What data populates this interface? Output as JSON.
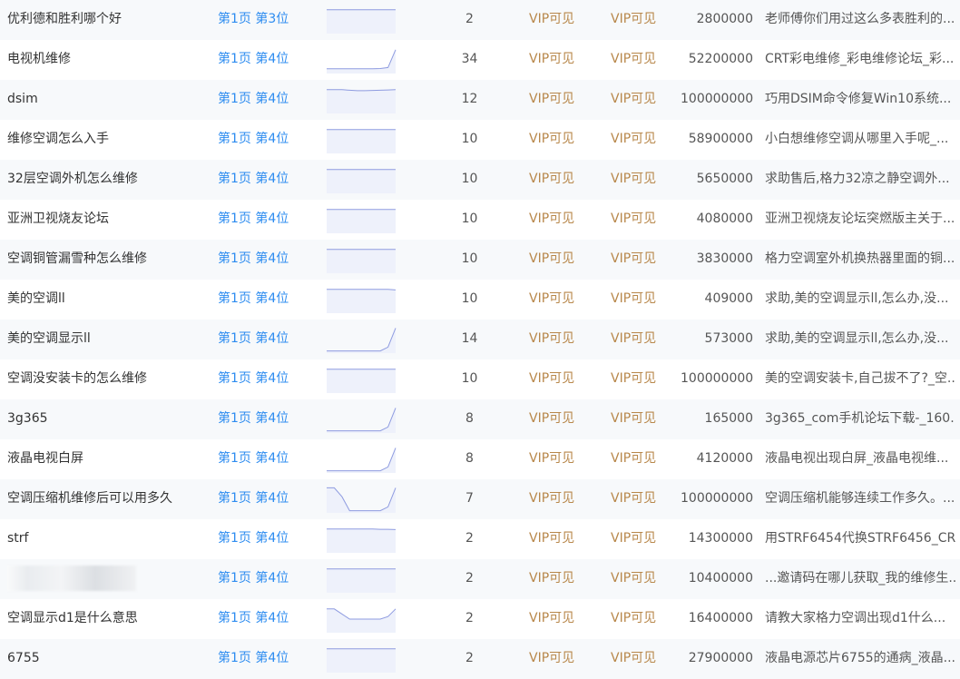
{
  "rows": [
    {
      "keyword": "优利德和胜利哪个好",
      "rank": "第1页 第3位",
      "trend": [
        0.9,
        0.9,
        0.9,
        0.9,
        0.9,
        0.9,
        0.9,
        0.9,
        0.9,
        0.9
      ],
      "count": "2",
      "vip1": "VIP可见",
      "vip2": "VIP可见",
      "volume": "2800000",
      "title": "老师傅你们用过这么多表胜利的..."
    },
    {
      "keyword": "电视机维修",
      "rank": "第1页 第4位",
      "trend": [
        0.15,
        0.15,
        0.15,
        0.15,
        0.15,
        0.15,
        0.15,
        0.16,
        0.2,
        0.9
      ],
      "count": "34",
      "vip1": "VIP可见",
      "vip2": "VIP可见",
      "volume": "52200000",
      "title": "CRT彩电维修_彩电维修论坛_彩..."
    },
    {
      "keyword": "dsim",
      "rank": "第1页 第4位",
      "trend": [
        0.9,
        0.9,
        0.9,
        0.88,
        0.86,
        0.86,
        0.87,
        0.88,
        0.89,
        0.9
      ],
      "count": "12",
      "vip1": "VIP可见",
      "vip2": "VIP可见",
      "volume": "100000000",
      "title": "巧用DSIM命令修复Win10系统..."
    },
    {
      "keyword": "维修空调怎么入手",
      "rank": "第1页 第4位",
      "trend": [
        0.9,
        0.9,
        0.9,
        0.9,
        0.9,
        0.9,
        0.9,
        0.9,
        0.9,
        0.9
      ],
      "count": "10",
      "vip1": "VIP可见",
      "vip2": "VIP可见",
      "volume": "58900000",
      "title": "小白想维修空调从哪里入手呢_..."
    },
    {
      "keyword": "32层空调外机怎么维修",
      "rank": "第1页 第4位",
      "trend": [
        0.9,
        0.9,
        0.9,
        0.9,
        0.9,
        0.9,
        0.9,
        0.9,
        0.9,
        0.9
      ],
      "count": "10",
      "vip1": "VIP可见",
      "vip2": "VIP可见",
      "volume": "5650000",
      "title": "求助售后,格力32凉之静空调外..."
    },
    {
      "keyword": "亚洲卫视烧友论坛",
      "rank": "第1页 第4位",
      "trend": [
        0.9,
        0.9,
        0.9,
        0.9,
        0.9,
        0.9,
        0.9,
        0.9,
        0.9,
        0.9
      ],
      "count": "10",
      "vip1": "VIP可见",
      "vip2": "VIP可见",
      "volume": "4080000",
      "title": "亚洲卫视烧友论坛突燃版主关于..."
    },
    {
      "keyword": "空调铜管漏雪种怎么维修",
      "rank": "第1页 第4位",
      "trend": [
        0.9,
        0.9,
        0.9,
        0.9,
        0.9,
        0.9,
        0.9,
        0.9,
        0.9,
        0.9
      ],
      "count": "10",
      "vip1": "VIP可见",
      "vip2": "VIP可见",
      "volume": "3830000",
      "title": "格力空调室外机换热器里面的铜..."
    },
    {
      "keyword": "美的空调ll",
      "rank": "第1页 第4位",
      "trend": [
        0.9,
        0.9,
        0.9,
        0.9,
        0.9,
        0.9,
        0.9,
        0.9,
        0.9,
        0.88
      ],
      "count": "10",
      "vip1": "VIP可见",
      "vip2": "VIP可见",
      "volume": "409000",
      "title": "求助,美的空调显示ll,怎么办,没..."
    },
    {
      "keyword": "美的空调显示ll",
      "rank": "第1页 第4位",
      "trend": [
        0.05,
        0.05,
        0.05,
        0.05,
        0.05,
        0.05,
        0.05,
        0.05,
        0.2,
        0.95
      ],
      "count": "14",
      "vip1": "VIP可见",
      "vip2": "VIP可见",
      "volume": "573000",
      "title": "求助,美的空调显示ll,怎么办,没..."
    },
    {
      "keyword": "空调没安装卡的怎么维修",
      "rank": "第1页 第4位",
      "trend": [
        0.9,
        0.9,
        0.9,
        0.9,
        0.9,
        0.9,
        0.9,
        0.9,
        0.9,
        0.9
      ],
      "count": "10",
      "vip1": "VIP可见",
      "vip2": "VIP可见",
      "volume": "100000000",
      "title": "美的空调安装卡,自己拔不了?_空..."
    },
    {
      "keyword": "3g365",
      "rank": "第1页 第4位",
      "trend": [
        0.05,
        0.05,
        0.05,
        0.05,
        0.05,
        0.05,
        0.05,
        0.05,
        0.2,
        0.95
      ],
      "count": "8",
      "vip1": "VIP可见",
      "vip2": "VIP可见",
      "volume": "165000",
      "title": "3g365_com手机论坛下载-_160..."
    },
    {
      "keyword": "液晶电视白屏",
      "rank": "第1页 第4位",
      "trend": [
        0.05,
        0.05,
        0.05,
        0.05,
        0.05,
        0.05,
        0.05,
        0.05,
        0.2,
        0.95
      ],
      "count": "8",
      "vip1": "VIP可见",
      "vip2": "VIP可见",
      "volume": "4120000",
      "title": "液晶电视出现白屏_液晶电视维..."
    },
    {
      "keyword": "空调压缩机维修后可以用多久",
      "rank": "第1页 第4位",
      "trend": [
        0.95,
        0.95,
        0.6,
        0.05,
        0.05,
        0.05,
        0.05,
        0.05,
        0.2,
        0.95
      ],
      "count": "7",
      "vip1": "VIP可见",
      "vip2": "VIP可见",
      "volume": "100000000",
      "title": "空调压缩机能够连续工作多久。..."
    },
    {
      "keyword": "strf",
      "rank": "第1页 第4位",
      "trend": [
        0.9,
        0.9,
        0.9,
        0.9,
        0.9,
        0.9,
        0.9,
        0.89,
        0.89,
        0.88
      ],
      "count": "2",
      "vip1": "VIP可见",
      "vip2": "VIP可见",
      "volume": "14300000",
      "title": "用STRF6454代换STRF6456_CR..."
    },
    {
      "keyword": "",
      "rank": "第1页 第4位",
      "trend": [
        0.9,
        0.9,
        0.9,
        0.9,
        0.9,
        0.9,
        0.9,
        0.9,
        0.9,
        0.9
      ],
      "count": "2",
      "vip1": "VIP可见",
      "vip2": "VIP可见",
      "volume": "10400000",
      "title": "...邀请码在哪儿获取_我的维修生..."
    },
    {
      "keyword": "空调显示d1是什么意思",
      "rank": "第1页 第4位",
      "trend": [
        0.9,
        0.9,
        0.7,
        0.5,
        0.5,
        0.5,
        0.5,
        0.5,
        0.6,
        0.9
      ],
      "count": "2",
      "vip1": "VIP可见",
      "vip2": "VIP可见",
      "volume": "16400000",
      "title": "请教大家格力空调出现d1什么..."
    },
    {
      "keyword": "6755",
      "rank": "第1页 第4位",
      "trend": [
        0.9,
        0.9,
        0.9,
        0.9,
        0.9,
        0.9,
        0.9,
        0.9,
        0.9,
        0.9
      ],
      "count": "2",
      "vip1": "VIP可见",
      "vip2": "VIP可见",
      "volume": "27900000",
      "title": "液晶电源芯片6755的通病_液晶..."
    }
  ],
  "colors": {
    "rank_link": "#2d8cf0",
    "vip_text": "#b8874a",
    "spark_line": "#8e9be0",
    "spark_fill": "#eef1fb"
  }
}
